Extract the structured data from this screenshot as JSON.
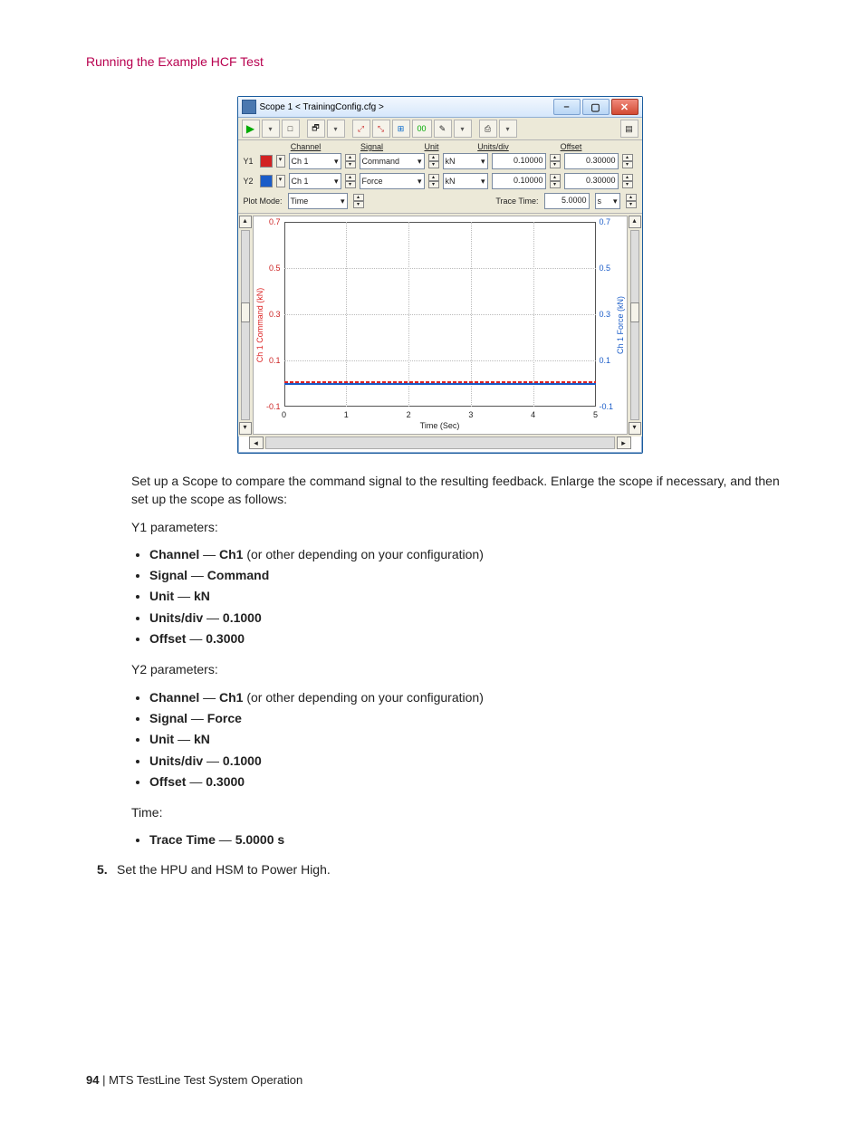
{
  "header": {
    "section_title": "Running the Example HCF Test"
  },
  "scope": {
    "window_title": "Scope 1 < TrainingConfig.cfg >",
    "columns": {
      "channel": "Channel",
      "signal": "Signal",
      "unit": "Unit",
      "units_div": "Units/div",
      "offset": "Offset"
    },
    "rows": {
      "y1": {
        "label": "Y1",
        "color": "#d22222",
        "channel": "Ch 1",
        "signal": "Command",
        "unit": "kN",
        "units_div": "0.10000",
        "offset": "0.30000"
      },
      "y2": {
        "label": "Y2",
        "color": "#1a5cc8",
        "channel": "Ch 1",
        "signal": "Force",
        "unit": "kN",
        "units_div": "0.10000",
        "offset": "0.30000"
      }
    },
    "plot_mode": {
      "label": "Plot Mode:",
      "value": "Time"
    },
    "trace_time": {
      "label": "Trace Time:",
      "value": "5.0000",
      "unit": "s"
    },
    "axes": {
      "left_label": "Ch 1 Command (kN)",
      "right_label": "Ch 1 Force (kN)",
      "x_label": "Time (Sec)"
    }
  },
  "instructions": {
    "intro": "Set up a Scope to compare the command signal to the resulting feedback. Enlarge the scope if necessary, and then set up the scope as follows:",
    "y1_header": "Y1 parameters:",
    "y2_header": "Y2 parameters:",
    "time_header": "Time:",
    "labels": {
      "channel": "Channel",
      "signal": "Signal",
      "unit": "Unit",
      "units_div": "Units/div",
      "offset": "Offset",
      "trace_time": "Trace Time",
      "sep": " — "
    },
    "y1": {
      "channel_val": "Ch1",
      "channel_note": " (or other depending on your configuration)",
      "signal_val": "Command",
      "unit_val": "kN",
      "units_div_val": "0.1000",
      "offset_val": "0.3000"
    },
    "y2": {
      "channel_val": "Ch1",
      "channel_note": " (or other depending on your configuration)",
      "signal_val": "Force",
      "unit_val": "kN",
      "units_div_val": "0.1000",
      "offset_val": "0.3000"
    },
    "time": {
      "trace_time_val": "5.0000 s"
    },
    "step5_num": "5.",
    "step5_text": "Set the HPU and HSM to Power High."
  },
  "footer": {
    "page_number": "94",
    "doc_title": "MTS TestLine Test System Operation",
    "sep": " | "
  },
  "chart_data": {
    "type": "line",
    "title": "",
    "xlabel": "Time (Sec)",
    "xlim": [
      0,
      5.0
    ],
    "x_ticks": [
      0,
      1.0,
      2.0,
      3.0,
      4.0,
      5.0
    ],
    "series": [
      {
        "name": "Ch 1 Command (kN)",
        "color": "#d22222",
        "axis": "left",
        "ylabel": "Ch 1 Command (kN)",
        "ylim": [
          -0.1,
          0.7
        ],
        "y_ticks": [
          -0.1,
          0.1,
          0.3,
          0.5,
          0.7
        ],
        "x": [
          0,
          5.0
        ],
        "values": [
          0.0,
          0.0
        ]
      },
      {
        "name": "Ch 1 Force (kN)",
        "color": "#1a5cc8",
        "axis": "right",
        "ylabel": "Ch 1 Force (kN)",
        "ylim": [
          -0.1,
          0.7
        ],
        "y_ticks": [
          -0.1,
          0.1,
          0.3,
          0.5,
          0.7
        ],
        "x": [
          0,
          5.0
        ],
        "values": [
          0.0,
          0.0
        ]
      }
    ]
  }
}
